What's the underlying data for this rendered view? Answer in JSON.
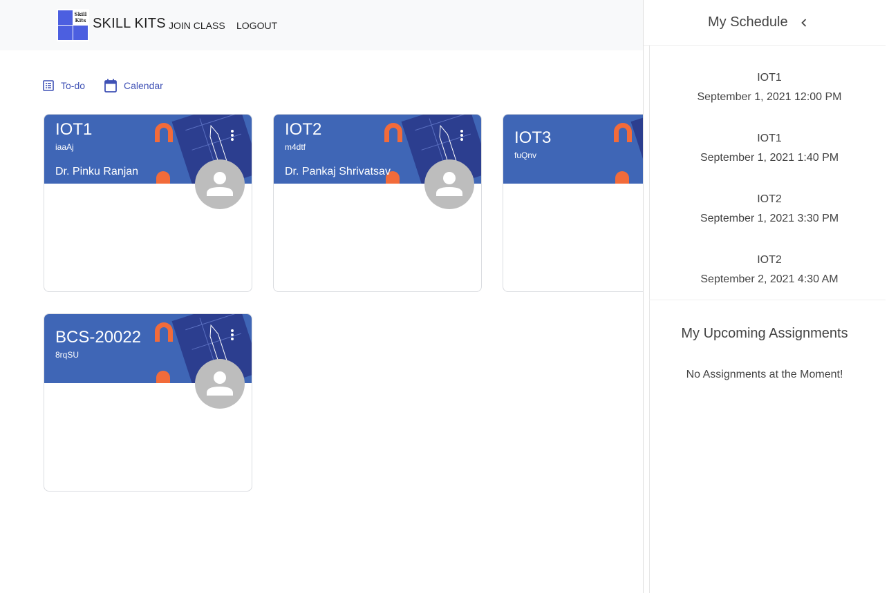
{
  "nav": {
    "brand": "SKILL KITS",
    "logo_text_1": "Skill",
    "logo_text_2": "Kits",
    "join_class": "JOIN CLASS",
    "logout": "LOGOUT"
  },
  "toolbar": {
    "todo": "To-do",
    "calendar": "Calendar"
  },
  "classes": [
    {
      "name": "IOT1",
      "code": "iaaAj",
      "teacher": "Dr. Pinku Ranjan"
    },
    {
      "name": "IOT2",
      "code": "m4dtf",
      "teacher": "Dr. Pankaj Shrivatsav"
    },
    {
      "name": "IOT3",
      "code": "fuQnv",
      "teacher": ""
    },
    {
      "name": "BCS-20022",
      "code": "8rqSU",
      "teacher": ""
    }
  ],
  "schedule": {
    "title": "My Schedule",
    "items": [
      {
        "class": "IOT1",
        "time": "September 1, 2021 12:00 PM"
      },
      {
        "class": "IOT1",
        "time": "September 1, 2021 1:40 PM"
      },
      {
        "class": "IOT2",
        "time": "September 1, 2021 3:30 PM"
      },
      {
        "class": "IOT2",
        "time": "September 2, 2021 4:30 AM"
      }
    ]
  },
  "assignments": {
    "title": "My Upcoming Assignments",
    "empty": "No Assignments at the Moment!"
  },
  "colors": {
    "accent": "#3f51b5",
    "card_header": "#3f66b6",
    "avatar": "#bdbdbd"
  }
}
